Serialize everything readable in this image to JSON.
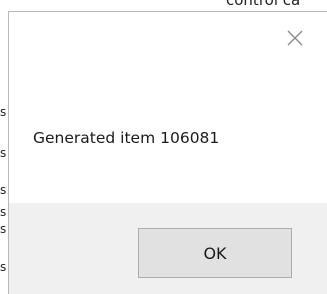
{
  "background": {
    "top_text": "control ca",
    "left_chars": [
      "s",
      "s",
      "s",
      "s",
      "s",
      "s"
    ]
  },
  "dialog": {
    "close_icon": "close-icon",
    "message": "Generated item 106081",
    "ok_label": "OK"
  },
  "colors": {
    "footer_bg": "#f0f0f0",
    "button_bg": "#e1e1e1",
    "button_border": "#adadad",
    "close_glyph": "#8a8a8a"
  }
}
